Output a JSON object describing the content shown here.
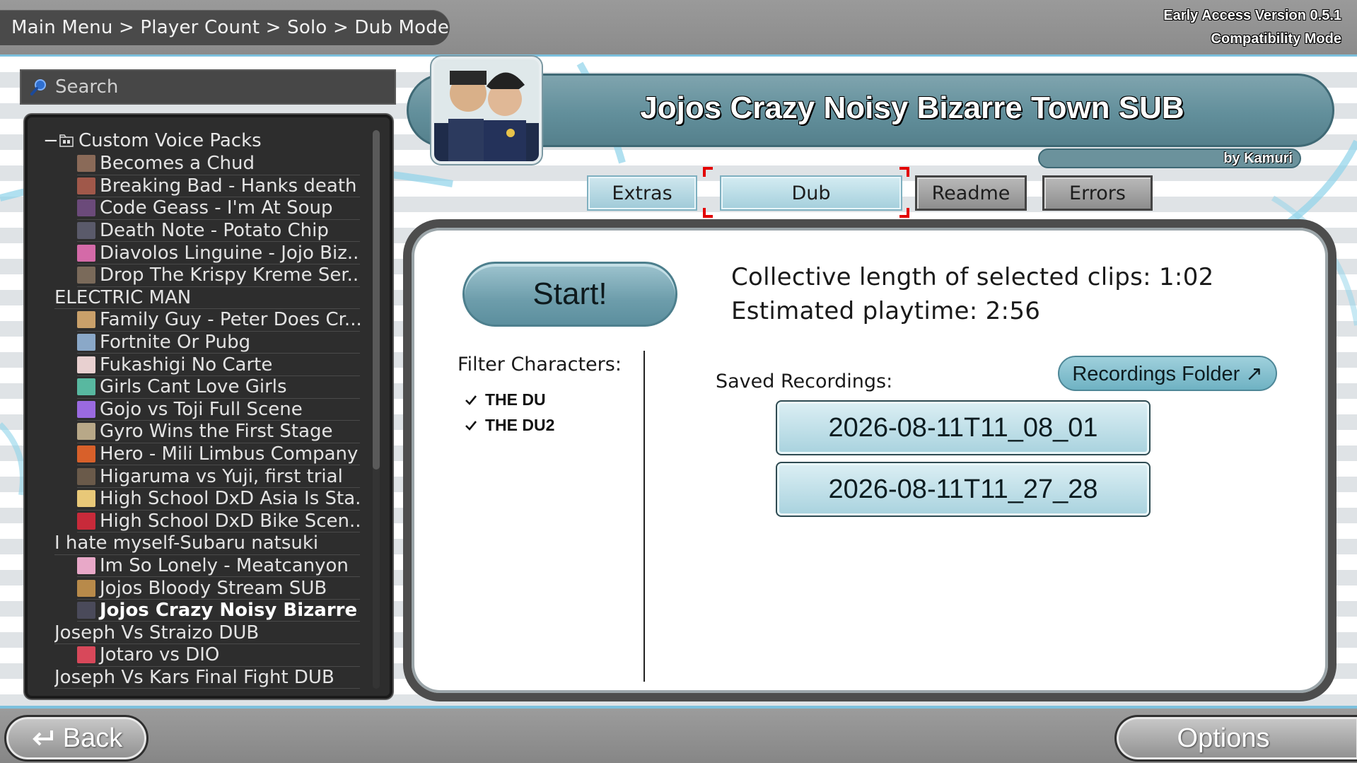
{
  "header": {
    "breadcrumb": "Main Menu > Player Count > Solo > Dub Mode",
    "version": "Early Access Version 0.5.1",
    "mode": "Compatibility Mode"
  },
  "search": {
    "placeholder": "Search"
  },
  "tree": {
    "root_label": "Custom Voice Packs",
    "items": [
      {
        "label": "Becomes a Chud",
        "thumb": "#8a6a58"
      },
      {
        "label": "Breaking Bad - Hanks death",
        "thumb": "#a0584a"
      },
      {
        "label": "Code Geass - I'm At Soup",
        "thumb": "#6b4a7a"
      },
      {
        "label": "Death Note - Potato Chip",
        "thumb": "#5a5a6a"
      },
      {
        "label": "Diavolos Linguine - Jojo Biz...",
        "thumb": "#d46aa8"
      },
      {
        "label": "Drop The Krispy Kreme Ser...",
        "thumb": "#7a6a5a"
      },
      {
        "label": "ELECTRIC MAN",
        "thumb": ""
      },
      {
        "label": "Family Guy - Peter Does Cr...",
        "thumb": "#c9a06a"
      },
      {
        "label": "Fortnite Or Pubg",
        "thumb": "#8aa8c8"
      },
      {
        "label": "Fukashigi No Carte",
        "thumb": "#e8d0d0"
      },
      {
        "label": "Girls Cant Love Girls",
        "thumb": "#58b8a0"
      },
      {
        "label": "Gojo vs Toji Full Scene",
        "thumb": "#9a6ae0"
      },
      {
        "label": "Gyro Wins the First Stage",
        "thumb": "#b8a888"
      },
      {
        "label": "Hero - Mili Limbus Company",
        "thumb": "#d8602a"
      },
      {
        "label": "Higaruma vs Yuji, first trial",
        "thumb": "#6a5a4a"
      },
      {
        "label": "High School DxD Asia Is Sta...",
        "thumb": "#e8c878"
      },
      {
        "label": "High School DxD Bike Scen...",
        "thumb": "#c82a3a"
      },
      {
        "label": "I hate myself-Subaru natsuki",
        "thumb": ""
      },
      {
        "label": "Im So Lonely - Meatcanyon",
        "thumb": "#e8a8c8"
      },
      {
        "label": "Jojos Bloody Stream SUB",
        "thumb": "#b88a4a"
      },
      {
        "label": "Jojos Crazy Noisy Bizarre T...",
        "thumb": "#4a4a5a",
        "selected": true
      },
      {
        "label": "Joseph Vs Straizo DUB",
        "thumb": ""
      },
      {
        "label": "Jotaro vs DIO",
        "thumb": "#d8485a"
      },
      {
        "label": "Joseph Vs Kars Final Fight DUB",
        "thumb": ""
      }
    ]
  },
  "pack": {
    "title": "Jojos Crazy Noisy Bizarre Town SUB",
    "author": "by Kamuri"
  },
  "tabs": {
    "extras": "Extras",
    "dub": "Dub",
    "readme": "Readme",
    "errors": "Errors"
  },
  "main": {
    "start_label": "Start!",
    "collective_length": "Collective length of selected clips:  1:02",
    "estimated_playtime": "Estimated playtime:  2:56",
    "filter_label": "Filter Characters:",
    "filters": [
      {
        "label": "THE DU",
        "checked": true
      },
      {
        "label": "THE DU2",
        "checked": true
      }
    ],
    "saved_label": "Saved Recordings:",
    "folder_button": "Recordings Folder ↗",
    "recordings": [
      "2026-08-11T11_08_01",
      "2026-08-11T11_27_28"
    ]
  },
  "footer": {
    "back_label": "Back",
    "options_label": "Options"
  },
  "colors": {
    "accent_blue": "#7cc0dd",
    "teal": "#628f9b",
    "selection_red": "#e30000"
  }
}
